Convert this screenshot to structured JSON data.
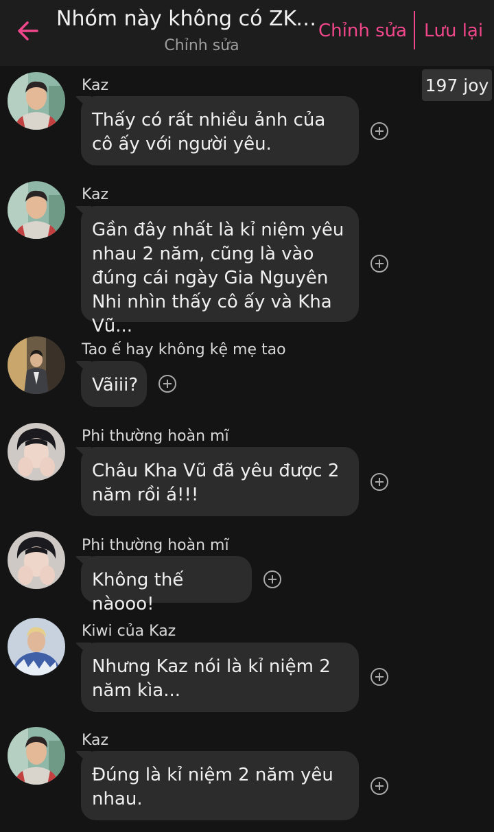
{
  "header": {
    "title": "Nhóm này không có ZKY...",
    "subtitle": "Chỉnh sửa",
    "edit_label": "Chỉnh sửa",
    "save_label": "Lưu lại",
    "accent_color": "#f0478a",
    "back_icon": "arrow-left-icon"
  },
  "joy_badge": "197 joy",
  "messages": [
    {
      "sender": "Kaz",
      "text": "Thấy có rất nhiều ảnh của cô ấy với người yêu.",
      "avatar": "kaz-avatar"
    },
    {
      "sender": "Kaz",
      "text": "Gần đây nhất là kỉ niệm yêu nhau 2 năm, cũng là vào đúng cái ngày Gia Nguyên Nhi nhìn thấy cô ấy và Kha Vũ...",
      "avatar": "kaz-avatar"
    },
    {
      "sender": "Tao ế hay không kệ mẹ tao",
      "text": "Vãiii?",
      "avatar": "suit-man-avatar"
    },
    {
      "sender": "Phi thường hoàn mĩ",
      "text": "Châu Kha Vũ đã yêu được 2 năm rồi á!!!",
      "avatar": "phi-avatar"
    },
    {
      "sender": "Phi thường hoàn mĩ",
      "text": "Không thế nàooo!",
      "avatar": "phi-avatar"
    },
    {
      "sender": "Kiwi của Kaz",
      "text": "Nhưng Kaz nói là kỉ niệm 2 năm kìa...",
      "avatar": "kiwi-avatar"
    },
    {
      "sender": "Kaz",
      "text": "Đúng là kỉ niệm 2 năm yêu nhau.",
      "avatar": "kaz-avatar"
    }
  ],
  "react_icon": "add-reaction-icon"
}
